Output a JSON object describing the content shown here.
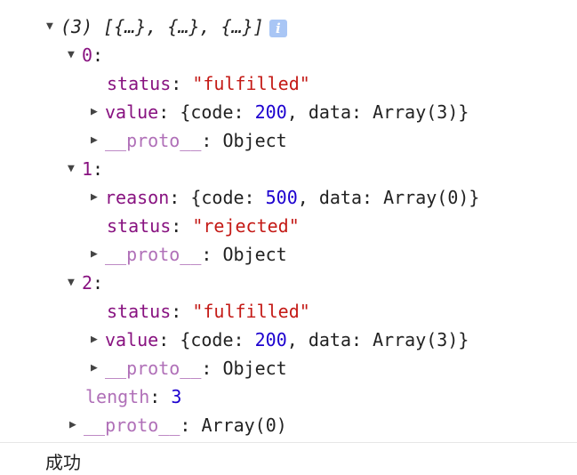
{
  "array_summary": {
    "length_label": "(3)",
    "preview": "[{…}, {…}, {…}]"
  },
  "items": [
    {
      "index": "0",
      "rows": [
        {
          "key": "status",
          "value": "\"fulfilled\""
        },
        {
          "key": "value",
          "obj_open": "{code: ",
          "code": "200",
          "obj_mid": ", data: ",
          "data": "Array(3)",
          "obj_close": "}"
        },
        {
          "key": "__proto__",
          "value": "Object"
        }
      ]
    },
    {
      "index": "1",
      "rows": [
        {
          "key": "reason",
          "obj_open": "{code: ",
          "code": "500",
          "obj_mid": ", data: ",
          "data": "Array(0)",
          "obj_close": "}"
        },
        {
          "key": "status",
          "value": "\"rejected\""
        },
        {
          "key": "__proto__",
          "value": "Object"
        }
      ]
    },
    {
      "index": "2",
      "rows": [
        {
          "key": "status",
          "value": "\"fulfilled\""
        },
        {
          "key": "value",
          "obj_open": "{code: ",
          "code": "200",
          "obj_mid": ", data: ",
          "data": "Array(3)",
          "obj_close": "}"
        },
        {
          "key": "__proto__",
          "value": "Object"
        }
      ]
    }
  ],
  "length": {
    "key": "length",
    "value": "3"
  },
  "array_proto": {
    "key": "__proto__",
    "value": "Array(0)"
  },
  "punct": {
    "colon": ": ",
    "colon_only": ":"
  },
  "icons": {
    "expanded": "▼",
    "collapsed": "▶",
    "info": "i"
  },
  "log_message": "成功",
  "colors": {
    "key": "#881280",
    "proto_key": "#b070b8",
    "string": "#c41a16",
    "number": "#1c00cf",
    "info_badge": "#a9c6f5"
  }
}
